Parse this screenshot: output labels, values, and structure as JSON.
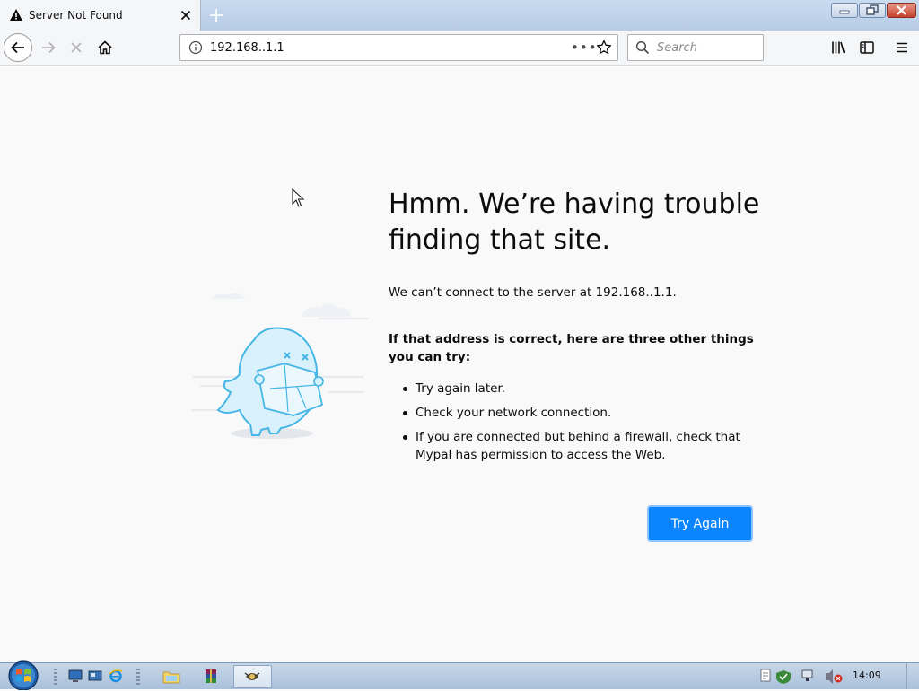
{
  "browser": {
    "tab": {
      "title": "Server Not Found"
    },
    "url": "192.168..1.1",
    "search_placeholder": "Search"
  },
  "error_page": {
    "title": "Hmm. We’re having trouble finding that site.",
    "description": "We can’t connect to the server at 192.168..1.1.",
    "tips_heading": "If that address is correct, here are three other things you can try:",
    "tips": [
      "Try again later.",
      "Check your network connection.",
      "If you are connected but behind a firewall, check that Mypal has permission to access the Web."
    ],
    "try_again_label": "Try Again"
  },
  "taskbar": {
    "clock": "14:09"
  },
  "colors": {
    "primary_button": "#0a84ff",
    "illustration": "#46b6e6"
  }
}
